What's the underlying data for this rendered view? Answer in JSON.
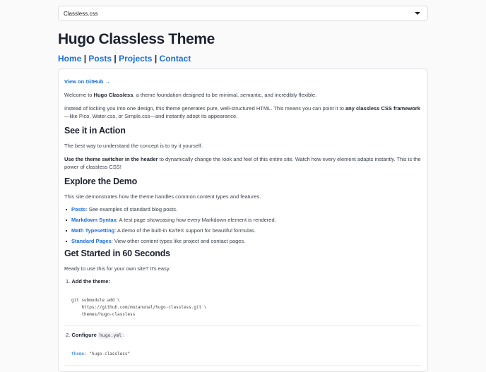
{
  "theme_select": {
    "value": "Classless.css"
  },
  "title": "Hugo Classless Theme",
  "nav": [
    {
      "label": "Home"
    },
    {
      "label": "Posts"
    },
    {
      "label": "Projects"
    },
    {
      "label": "Contact"
    }
  ],
  "nav_sep": "|",
  "content": {
    "github_link": "View on GitHub →",
    "intro": {
      "pre": "Welcome to ",
      "bold": "Hugo Classless",
      "post": ", a theme foundation designed to be minimal, semantic, and incredibly flexible."
    },
    "para2": {
      "pre": "Instead of locking you into one design, this theme generates pure, well-structured HTML. This means you can point it to ",
      "bold": "any classless CSS framework",
      "post": "—like Pico, Water.css, or Simple.css—and instantly adopt its appearance."
    },
    "h_action": "See it in Action",
    "action_p1": "The best way to understand the concept is to try it yourself.",
    "action_p2": {
      "bold": "Use the theme switcher in the header",
      "post": " to dynamically change the look and feel of this entire site. Watch how every element adapts instantly. This is the power of classless CSS!"
    },
    "h_demo": "Explore the Demo",
    "demo_p": "This site demonstrates how the theme handles common content types and features.",
    "demo_items": [
      {
        "link": "Posts",
        "text": ": See examples of standard blog posts."
      },
      {
        "link": "Markdown Syntax",
        "text": ": A test page showcasing how every Markdown element is rendered."
      },
      {
        "link": "Math Typesetting",
        "text": ": A demo of the built-in KaTeX support for beautiful formulas."
      },
      {
        "link": "Standard Pages",
        "text": ": View other content types like project and contact pages."
      }
    ],
    "h_start": "Get Started in 60 Seconds",
    "start_p": "Ready to use this for your own site? It's easy.",
    "step1": {
      "num": "1.",
      "label": "Add the theme:"
    },
    "code1": "git submodule add \\\n    https://github.com/mozanunal/hugo-classless.git \\\n    themes/hugo-classless",
    "step2": {
      "num": "2.",
      "label": "Configure",
      "code": "hugo.yml",
      "colon": ":"
    },
    "code2": {
      "key": "theme",
      "rest": ": \"hugo-classless\""
    }
  }
}
